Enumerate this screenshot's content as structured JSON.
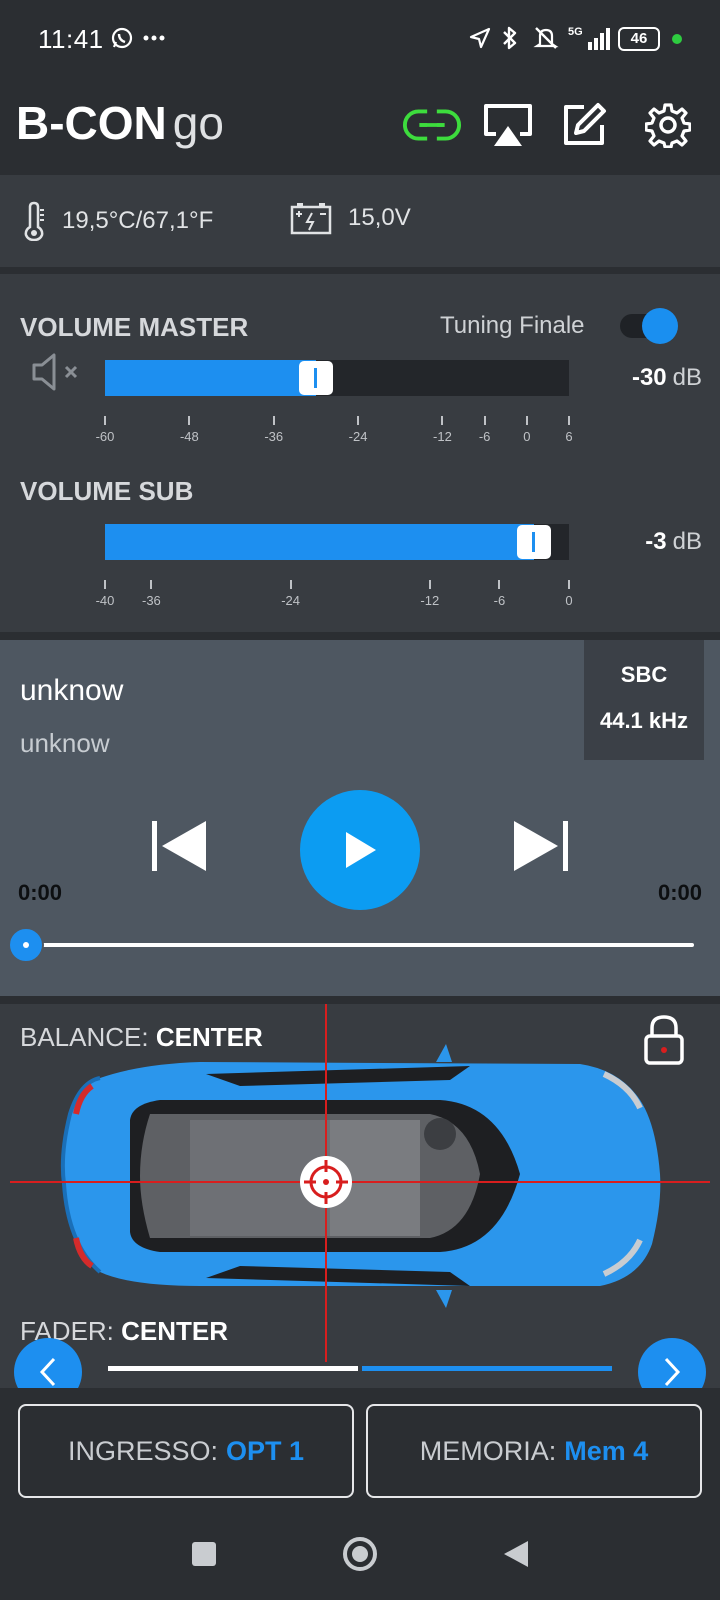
{
  "status_bar": {
    "time": "11:41",
    "battery": "46",
    "network": "5G",
    "icons": [
      "whatsapp-icon",
      "more-dots-icon",
      "location-icon",
      "bluetooth-icon",
      "mute-icon",
      "signal-icon"
    ]
  },
  "header": {
    "brand_bold": "B-CON",
    "brand_light": "go",
    "icons": [
      "link-icon",
      "airplay-icon",
      "edit-icon",
      "gear-icon"
    ],
    "colors": {
      "link_active": "#3ddc3d"
    }
  },
  "info": {
    "temperature": "19,5°C/67,1°F",
    "voltage": "15,0V"
  },
  "volume": {
    "master_title": "VOLUME MASTER",
    "tuning_label": "Tuning Finale",
    "tuning_on": true,
    "master_value": "-30",
    "master_unit": "dB",
    "master_ticks": [
      "-60",
      "-48",
      "-36",
      "-24",
      "-12",
      "-6",
      "0",
      "6"
    ],
    "sub_title": "VOLUME SUB",
    "sub_value": "-3",
    "sub_unit": "dB",
    "sub_ticks": [
      "-40",
      "-36",
      "-24",
      "-12",
      "-6",
      "0"
    ]
  },
  "player": {
    "title": "unknow",
    "artist": "unknow",
    "codec": "SBC",
    "sample_rate": "44.1 kHz",
    "time_elapsed": "0:00",
    "time_total": "0:00",
    "progress": 0
  },
  "balance": {
    "balance_label": "BALANCE:",
    "balance_value": "CENTER",
    "fader_label": "FADER:",
    "fader_value": "CENTER",
    "page": 1,
    "pages": 2
  },
  "selectors": {
    "input_label": "INGRESSO:",
    "input_value": "OPT 1",
    "memory_label": "MEMORIA:",
    "memory_value": "Mem 4"
  },
  "colors": {
    "accent": "#1d8ff0",
    "background": "#2b2e32",
    "panel": "#383c41",
    "player_panel": "#4e5761"
  }
}
